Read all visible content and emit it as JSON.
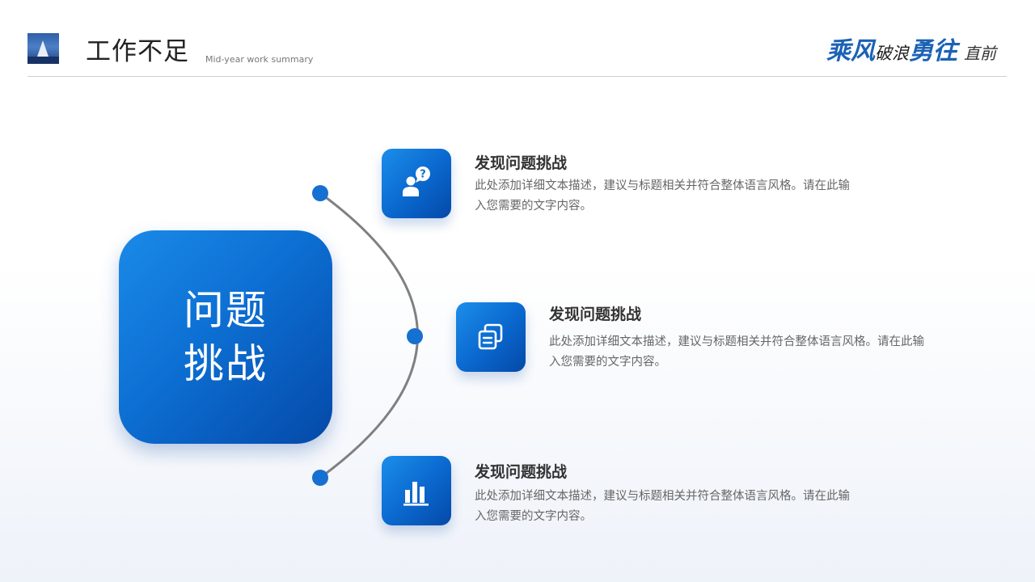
{
  "header": {
    "title": "工作不足",
    "subtitle": "Mid-year work summary",
    "slogan": {
      "part1": "乘风",
      "part2": "破浪",
      "part3": "勇往",
      "part4": "直前"
    }
  },
  "main": {
    "label": "问题挑战"
  },
  "items": [
    {
      "icon": "user-question-icon",
      "title": "发现问题挑战",
      "desc": "此处添加详细文本描述，建议与标题相关并符合整体语言风格。请在此输入您需要的文字内容。"
    },
    {
      "icon": "copy-document-icon",
      "title": "发现问题挑战",
      "desc": "此处添加详细文本描述，建议与标题相关并符合整体语言风格。请在此输入您需要的文字内容。"
    },
    {
      "icon": "bar-chart-icon",
      "title": "发现问题挑战",
      "desc": "此处添加详细文本描述，建议与标题相关并符合整体语言风格。请在此输入您需要的文字内容。"
    }
  ],
  "colors": {
    "accent": "#0d6fd3",
    "accent_dark": "#0449a8",
    "arc_line": "#808080",
    "text_dark": "#333333",
    "text_muted": "#666666"
  }
}
